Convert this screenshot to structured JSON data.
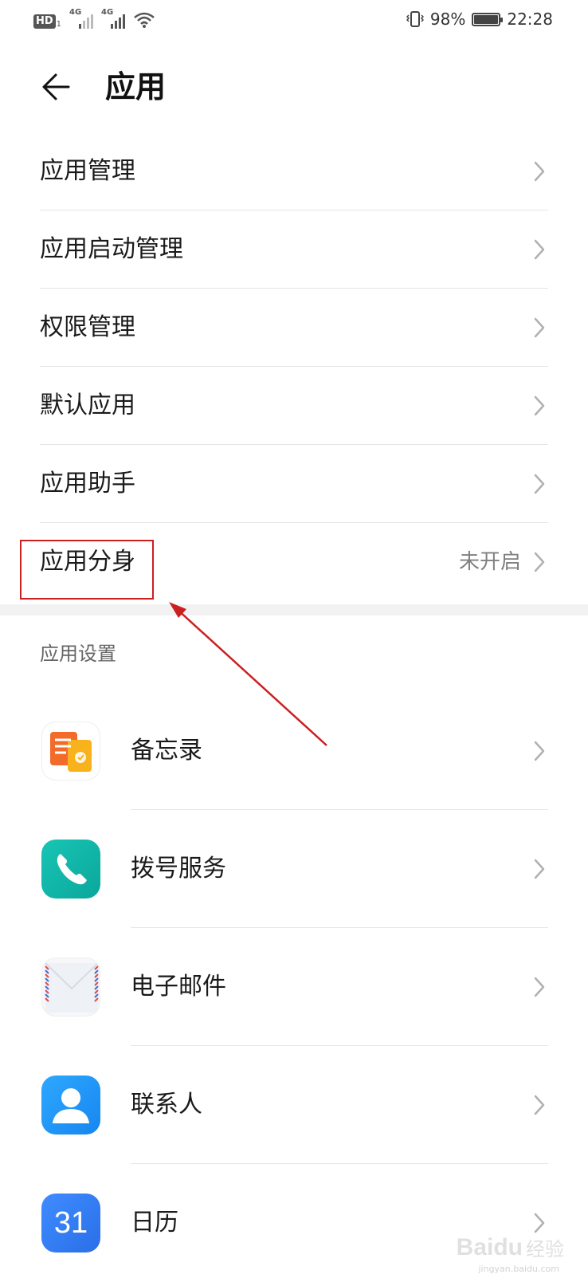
{
  "status_bar": {
    "hd": "HD",
    "hd_sub": "1",
    "network1": "4G",
    "network2": "4G",
    "battery_percent": "98%",
    "battery_level": 0.98,
    "time": "22:28"
  },
  "header": {
    "title": "应用"
  },
  "menu": {
    "items": [
      {
        "label": "应用管理"
      },
      {
        "label": "应用启动管理"
      },
      {
        "label": "权限管理"
      },
      {
        "label": "默认应用"
      },
      {
        "label": "应用助手"
      },
      {
        "label": "应用分身",
        "value": "未开启"
      }
    ]
  },
  "app_settings": {
    "section_title": "应用设置",
    "apps": [
      {
        "label": "备忘录",
        "icon": "notepad-icon"
      },
      {
        "label": "拨号服务",
        "icon": "phone-icon"
      },
      {
        "label": "电子邮件",
        "icon": "email-icon"
      },
      {
        "label": "联系人",
        "icon": "contacts-icon"
      },
      {
        "label": "日历",
        "icon": "calendar-icon",
        "icon_text": "31"
      }
    ]
  },
  "annotation": {
    "color": "#cc1f1f"
  },
  "watermark": {
    "brand": "Baidu",
    "cn": "经验",
    "url": "jingyan.baidu.com"
  }
}
